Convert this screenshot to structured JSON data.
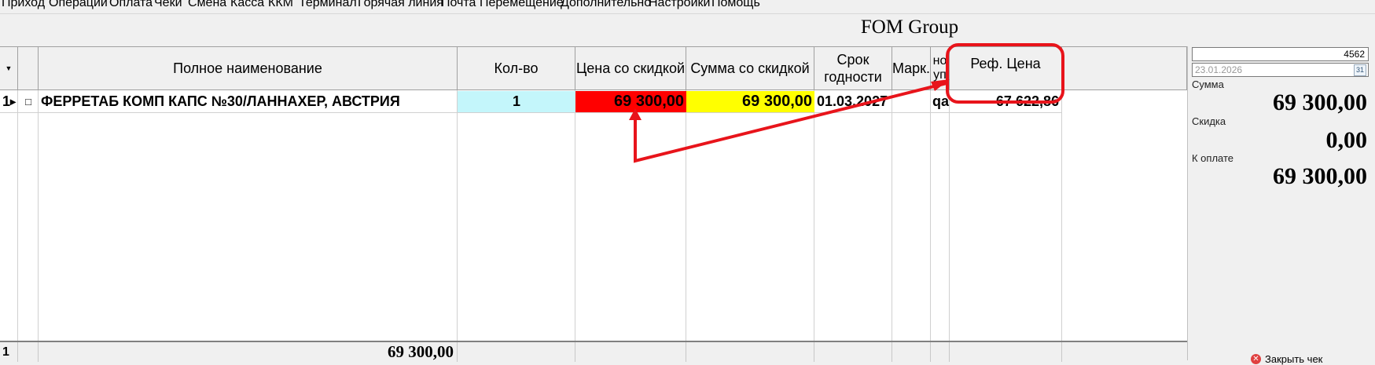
{
  "menu": [
    "Приход",
    "Операции",
    "Оплата",
    "Чеки",
    "Смена",
    "Касса",
    "ККМ",
    "Терминал",
    "Горячая линия",
    "Почта",
    "Перемещение",
    "Дополнительно",
    "Настройки",
    "Помощь"
  ],
  "company": "FOM Group",
  "grid": {
    "headers": {
      "name": "Полное наименование",
      "qty": "Кол-во",
      "price_disc": "Цена со скидкой",
      "sum_disc": "Сумма со скидкой",
      "expiry": "Срок годности",
      "mark": "Марк.",
      "extra": "но уп",
      "ref_price": "Реф. Цена"
    },
    "rows": [
      {
        "num": "1",
        "indicator": "▸",
        "name": "ФЕРРЕТАБ КОМП КАПС №30/ЛАННАХЕР, АВСТРИЯ",
        "qty": "1",
        "price_disc": "69 300,00",
        "sum_disc": "69 300,00",
        "expiry": "01.03.2027",
        "mark": "",
        "extra": "qa",
        "ref_price": "67 622,86"
      }
    ],
    "footer": {
      "count": "1",
      "total": "69 300,00"
    }
  },
  "panel": {
    "code": "4562",
    "date": "23.01.2026",
    "date_btn": "31",
    "sum_label": "Сумма",
    "sum_value": "69 300,00",
    "discount_label": "Скидка",
    "discount_value": "0,00",
    "pay_label": "К оплате",
    "pay_value": "69 300,00",
    "close_label": "Закрыть чек"
  },
  "colors": {
    "price_bg": "#ff0000",
    "sum_bg": "#ffff00",
    "qty_bg": "#c4f6fb",
    "annotation": "#e8141b"
  }
}
